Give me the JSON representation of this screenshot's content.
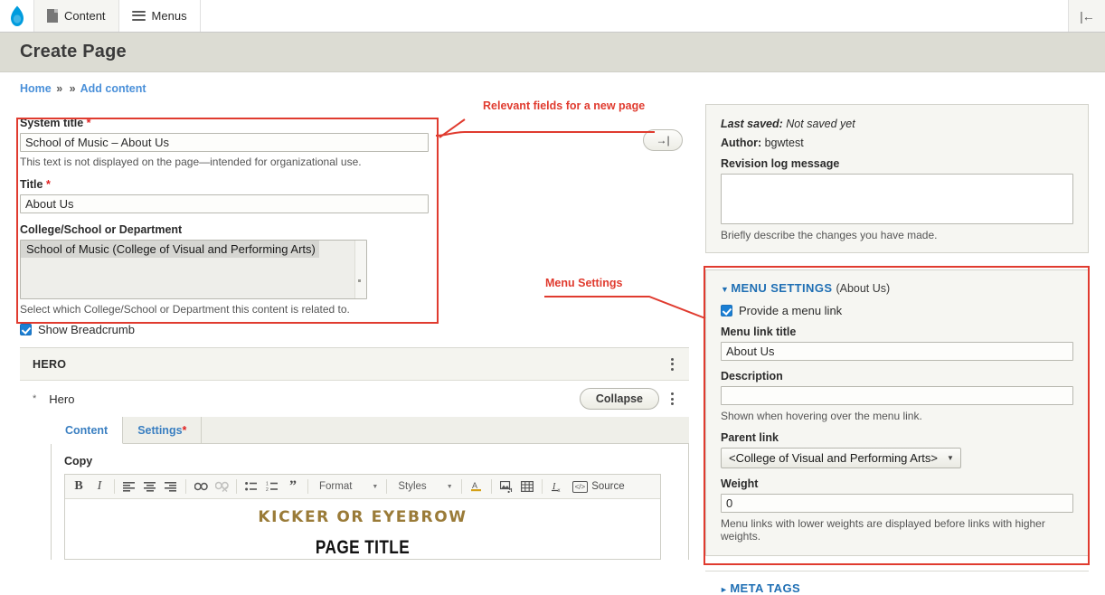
{
  "toolbar": {
    "logo_name": "drupal-logo",
    "items": [
      {
        "label": "Content",
        "icon": "document-icon"
      },
      {
        "label": "Menus",
        "icon": "hamburger-icon"
      }
    ],
    "collapse_icon": "collapse-toolbar-icon",
    "collapse_glyph": "|←"
  },
  "page": {
    "title": "Create Page"
  },
  "breadcrumb": {
    "items": [
      "Home",
      "Add content"
    ],
    "separator": "»"
  },
  "form": {
    "system_title": {
      "label": "System title",
      "required": "*",
      "value": "School of Music – About Us",
      "description": "This text is not displayed on the page—intended for organizational use."
    },
    "title": {
      "label": "Title",
      "required": "*",
      "value": "About Us"
    },
    "college": {
      "label": "College/School or Department",
      "options": [
        "School of Music (College of Visual and Performing Arts)"
      ],
      "selected": "School of Music (College of Visual and Performing Arts)",
      "description": "Select which College/School or Department this content is related to."
    },
    "show_breadcrumb": {
      "label": "Show Breadcrumb",
      "checked": true
    }
  },
  "hero": {
    "section_label": "HERO",
    "paragraph_label": "Hero",
    "paragraph_marker": "*",
    "collapse_label": "Collapse",
    "kebab_icon": "kebab-menu-icon",
    "tabs": [
      {
        "label": "Content",
        "required": "",
        "active": true
      },
      {
        "label": "Settings",
        "required": "*",
        "active": false
      }
    ],
    "copy_label": "Copy",
    "editor": {
      "buttons": [
        {
          "name": "bold-icon",
          "glyph": "B"
        },
        {
          "name": "italic-icon",
          "glyph": "I"
        },
        {
          "name": "align-left-icon",
          "glyph": ""
        },
        {
          "name": "align-center-icon",
          "glyph": ""
        },
        {
          "name": "align-right-icon",
          "glyph": ""
        },
        {
          "name": "link-icon",
          "glyph": "⚭"
        },
        {
          "name": "unlink-icon",
          "glyph": "⚭"
        },
        {
          "name": "bulleted-list-icon",
          "glyph": ""
        },
        {
          "name": "numbered-list-icon",
          "glyph": ""
        },
        {
          "name": "blockquote-icon",
          "glyph": "”"
        },
        {
          "name": "text-color-icon",
          "glyph": "A"
        },
        {
          "name": "media-icon",
          "glyph": ""
        },
        {
          "name": "table-icon",
          "glyph": ""
        },
        {
          "name": "remove-format-icon",
          "glyph": "I"
        }
      ],
      "format_label": "Format",
      "styles_label": "Styles",
      "source_label": "Source",
      "content": {
        "kicker": "KICKER OR EYEBROW",
        "page_title": "PAGE TITLE"
      }
    }
  },
  "sidebar": {
    "last_saved_label": "Last saved:",
    "last_saved_value": "Not saved yet",
    "author_label": "Author:",
    "author_value": "bgwtest",
    "revision_log_label": "Revision log message",
    "revision_log_value": "",
    "revision_log_desc": "Briefly describe the changes you have made.",
    "menu_settings": {
      "title": "MENU SETTINGS",
      "subtitle": "(About Us)",
      "triangle": "▼",
      "provide_menu_link": {
        "label": "Provide a menu link",
        "checked": true
      },
      "menu_link_title": {
        "label": "Menu link title",
        "value": "About Us"
      },
      "description_field": {
        "label": "Description",
        "value": "",
        "desc": "Shown when hovering over the menu link."
      },
      "parent_link": {
        "label": "Parent link",
        "value": "<College of Visual and Performing Arts>",
        "caret": "▼"
      },
      "weight": {
        "label": "Weight",
        "value": "0",
        "desc": "Menu links with lower weights are displayed before links with higher weights."
      }
    },
    "meta_tags": {
      "title": "META TAGS",
      "triangle": "►"
    }
  },
  "annotations": [
    {
      "text": "Relevant fields for a new page"
    },
    {
      "text": "Menu Settings"
    }
  ],
  "mid_button": {
    "name": "collapse-sidebar-button",
    "glyph": "→|"
  },
  "colors": {
    "accent_blue": "#4a90d9",
    "annotation_red": "#e03b2f",
    "kicker_gold": "#9a7b38",
    "header_bg": "#dcdcd3"
  }
}
